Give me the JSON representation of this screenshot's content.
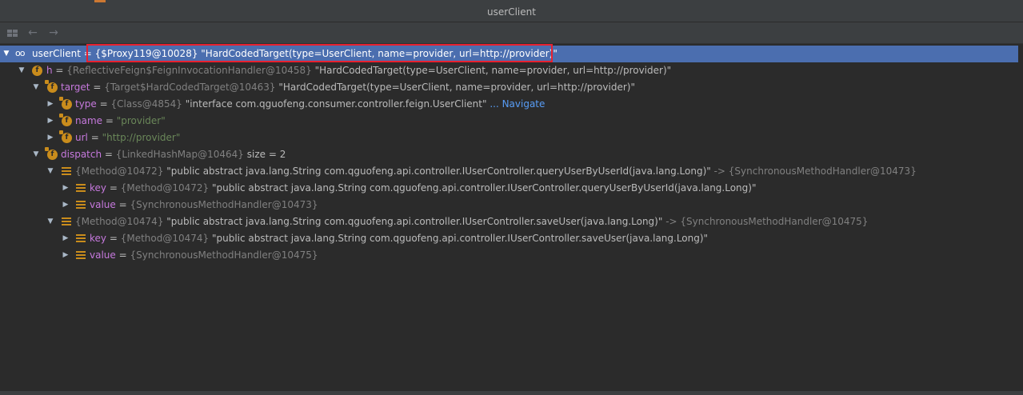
{
  "window": {
    "title": "userClient"
  },
  "toolbar": {
    "buttons": [
      {
        "name": "layout-icon"
      },
      {
        "name": "back-arrow-icon"
      },
      {
        "name": "forward-arrow-icon"
      }
    ],
    "back_glyph": "←",
    "forward_glyph": "→"
  },
  "tree": {
    "rows": [
      {
        "arrow": "▼",
        "icon": "watch",
        "name": "userClient",
        "eq": " = ",
        "type": "{$Proxy119@10028}",
        "value": " \"HardCodedTarget(type=UserClient, name=provider, url=http://provider)\"",
        "selected": true
      },
      {
        "arrow": "▼",
        "icon": "f",
        "name": "h",
        "eq": " = ",
        "type": "{ReflectiveFeign$FeignInvocationHandler@10458}",
        "value": " \"HardCodedTarget(type=UserClient, name=provider, url=http://provider)\""
      },
      {
        "arrow": "▼",
        "icon": "f-locked",
        "name": "target",
        "eq": " = ",
        "type": "{Target$HardCodedTarget@10463}",
        "value": " \"HardCodedTarget(type=UserClient, name=provider, url=http://provider)\""
      },
      {
        "arrow": "▶",
        "icon": "f-locked",
        "name": "type",
        "eq": " = ",
        "type": "{Class@4854}",
        "value": " \"interface com.qguofeng.consumer.controller.feign.UserClient\"",
        "link": " ... Navigate"
      },
      {
        "arrow": "▶",
        "icon": "f-locked",
        "name": "name",
        "eq": " = ",
        "type": "",
        "value_green": "\"provider\""
      },
      {
        "arrow": "▶",
        "icon": "f-locked",
        "name": "url",
        "eq": " = ",
        "type": "",
        "value_green": "\"http://provider\""
      },
      {
        "arrow": "▼",
        "icon": "f-locked",
        "name": "dispatch",
        "eq": " = ",
        "type": "{LinkedHashMap@10464}",
        "value": "  size = 2"
      },
      {
        "arrow": "▼",
        "icon": "list",
        "name": "",
        "eq": "",
        "type": "{Method@10472}",
        "value": " \"public abstract java.lang.String com.qguofeng.api.controller.IUserController.queryUserByUserId(java.lang.Long)\"",
        "arrow_to": " -> ",
        "type2": "{SynchronousMethodHandler@10473}"
      },
      {
        "arrow": "▶",
        "icon": "list",
        "name": "key",
        "eq": " = ",
        "type": "{Method@10472}",
        "value": " \"public abstract java.lang.String com.qguofeng.api.controller.IUserController.queryUserByUserId(java.lang.Long)\""
      },
      {
        "arrow": "▶",
        "icon": "list",
        "name": "value",
        "eq": " = ",
        "type": "{SynchronousMethodHandler@10473}",
        "value": ""
      },
      {
        "arrow": "▼",
        "icon": "list",
        "name": "",
        "eq": "",
        "type": "{Method@10474}",
        "value": " \"public abstract java.lang.String com.qguofeng.api.controller.IUserController.saveUser(java.lang.Long)\"",
        "arrow_to": " -> ",
        "type2": "{SynchronousMethodHandler@10475}"
      },
      {
        "arrow": "▶",
        "icon": "list",
        "name": "key",
        "eq": " = ",
        "type": "{Method@10474}",
        "value": " \"public abstract java.lang.String com.qguofeng.api.controller.IUserController.saveUser(java.lang.Long)\""
      },
      {
        "arrow": "▶",
        "icon": "list",
        "name": "value",
        "eq": " = ",
        "type": "{SynchronousMethodHandler@10475}",
        "value": ""
      }
    ]
  },
  "colors": {
    "selection": "#4b6eaf",
    "highlight_box": "#e8212f",
    "field_icon": "#c98c1c",
    "background": "#2b2b2b"
  }
}
